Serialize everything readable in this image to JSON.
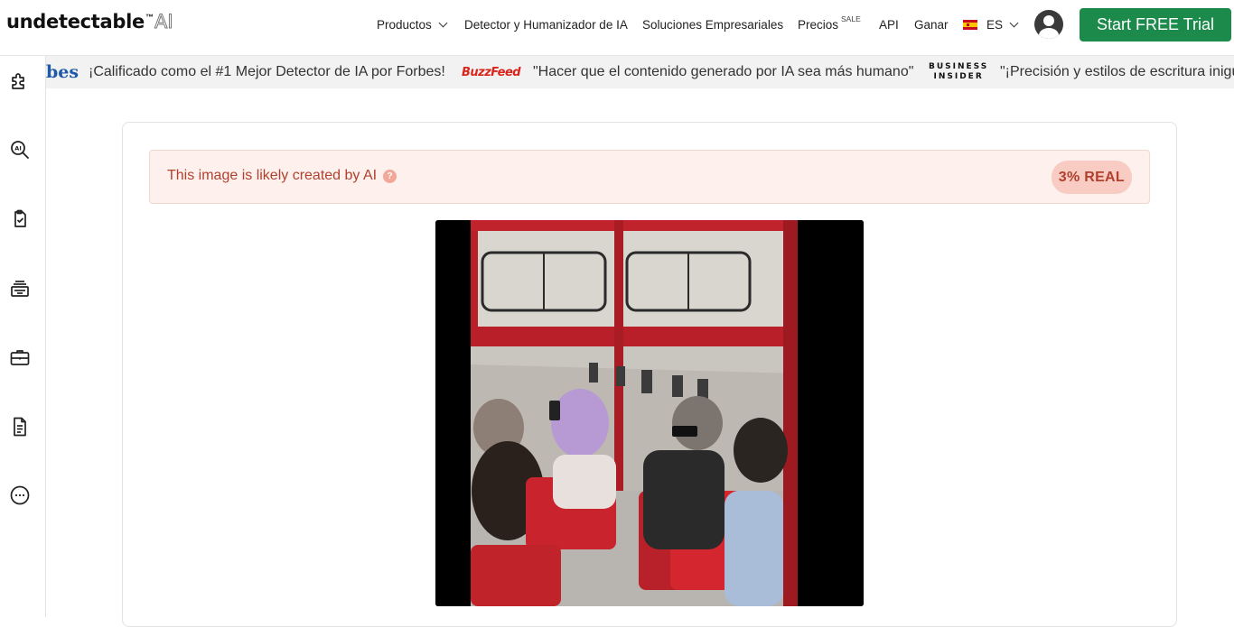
{
  "logo": {
    "main": "undetectable",
    "tm": "™",
    "ai": "AI"
  },
  "nav": {
    "products": "Productos",
    "detector": "Detector y Humanizador de IA",
    "enterprise": "Soluciones Empresariales",
    "pricing": "Precios",
    "sale": "SALE",
    "api": "API",
    "earn": "Ganar",
    "language": "ES"
  },
  "cta": "Start FREE Trial",
  "ticker": {
    "forbes_logo": "bes",
    "quote1": "¡Calificado como el #1 Mejor Detector de IA por Forbes!",
    "buzzfeed_logo": "BuzzFeed",
    "quote2": "\"Hacer que el contenido generado por IA sea más humano\"",
    "bi_line1": "BUSINESS",
    "bi_line2": "INSIDER",
    "quote3": "\"¡Precisión y estilos de escritura inigua"
  },
  "sidebar": {
    "icons": [
      "puzzle-icon",
      "search-ai-icon",
      "document-check-icon",
      "stack-icon",
      "briefcase-icon",
      "document-icon",
      "more-icon"
    ]
  },
  "result": {
    "message": "This image is likely created by AI",
    "help": "?",
    "score": "3% REAL"
  },
  "colors": {
    "cta": "#1c8a4a",
    "alert_bg": "#fdf0ed",
    "alert_text": "#b0412e",
    "badge_bg": "#f8cbc3",
    "forbes": "#1e5aa8",
    "buzzfeed": "#d9261c"
  }
}
